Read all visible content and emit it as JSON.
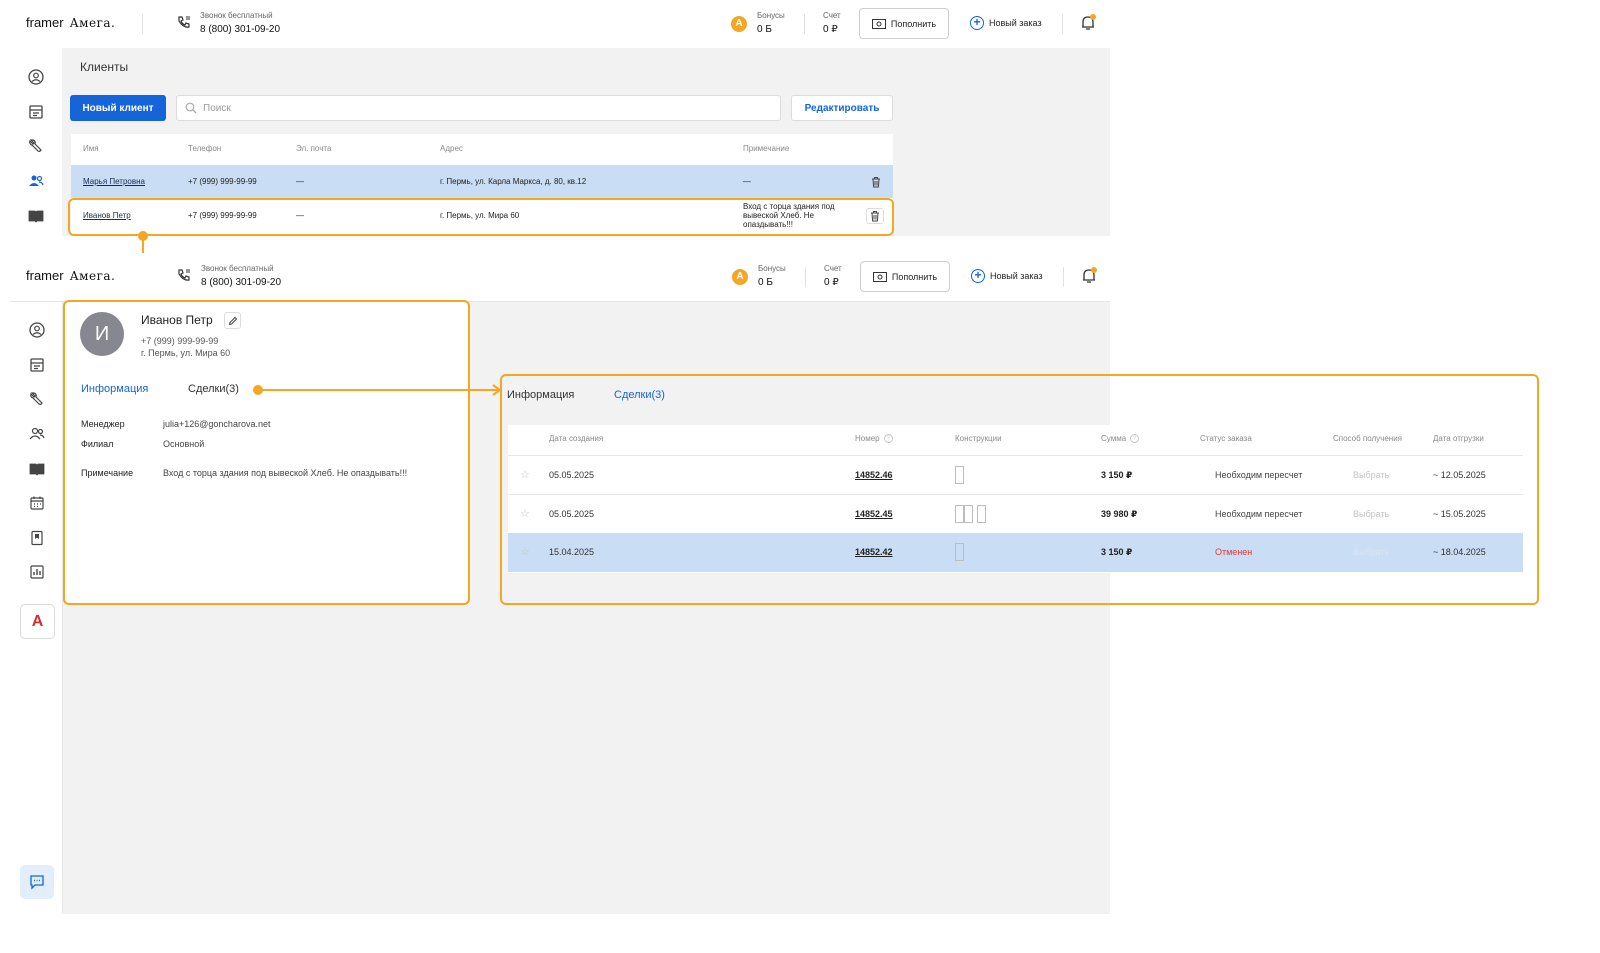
{
  "header": {
    "brand": "framer",
    "brand2": "Амега.",
    "call_label": "Звонок бесплатный",
    "call_number": "8 (800) 301-09-20",
    "bonus_label": "Бонусы",
    "bonus_value": "0 Б",
    "account_label": "Счет",
    "account_value": "0 ₽",
    "topup_label": "Пополнить",
    "new_order_label": "Новый заказ",
    "bonus_icon_letter": "А"
  },
  "clients_page": {
    "title": "Клиенты",
    "new_client_label": "Новый клиент",
    "search_placeholder": "Поиск",
    "edit_label": "Редактировать",
    "columns": [
      "Имя",
      "Телефон",
      "Эл. почта",
      "Адрес",
      "Примечание"
    ],
    "rows": [
      {
        "name": "Марья Петровна",
        "phone": "+7 (999) 999-99-99",
        "email": "—",
        "address": "г. Пермь, ул. Карла Маркса, д. 80, кв.12",
        "note": "—"
      },
      {
        "name": "Иванов Петр",
        "phone": "+7 (999) 999-99-99",
        "email": "—",
        "address": "г. Пермь, ул. Мира 60",
        "note": "Вход с торца здания под вывеской Хлеб. Не опаздывать!!!"
      }
    ]
  },
  "client_card": {
    "avatar_letter": "И",
    "name": "Иванов Петр",
    "phone": "+7 (999) 999-99-99",
    "address": "г. Пермь, ул. Мира 60",
    "tab_info": "Информация",
    "tab_deals": "Сделки(3)",
    "fields": [
      {
        "key": "Менеджер",
        "value": "julia+126@goncharova.net"
      },
      {
        "key": "Филиал",
        "value": "Основной"
      },
      {
        "key": "Примечание",
        "value": "Вход с торца здания под вывеской Хлеб. Не опаздывать!!!"
      }
    ]
  },
  "deals_panel": {
    "tab_info": "Информация",
    "tab_deals": "Сделки(3)",
    "columns": [
      "Дата создания",
      "Номер",
      "Конструкции",
      "Сумма",
      "Статус заказа",
      "Способ получения",
      "Дата отгрузки"
    ],
    "rows": [
      {
        "date": "05.05.2025",
        "number": "14852.46",
        "sum": "3 150 ₽",
        "status": "Необходим пересчет",
        "delivery": "Выбрать",
        "ship_date": "~ 12.05.2025",
        "status_color": "#444444",
        "windows": 1
      },
      {
        "date": "05.05.2025",
        "number": "14852.45",
        "sum": "39 980 ₽",
        "status": "Необходим пересчет",
        "delivery": "Выбрать",
        "ship_date": "~ 15.05.2025",
        "status_color": "#444444",
        "windows": 3
      },
      {
        "date": "15.04.2025",
        "number": "14852.42",
        "sum": "3 150 ₽",
        "status": "Отменен",
        "delivery": "Выбрать",
        "ship_date": "~ 18.04.2025",
        "status_color": "#e53935",
        "windows": 1
      }
    ]
  },
  "colors": {
    "accent": "#1565d8",
    "annotation": "#f5a623",
    "selected_row": "#c9ddf4",
    "danger": "#e53935"
  },
  "sidebar_logo_letter": "А"
}
